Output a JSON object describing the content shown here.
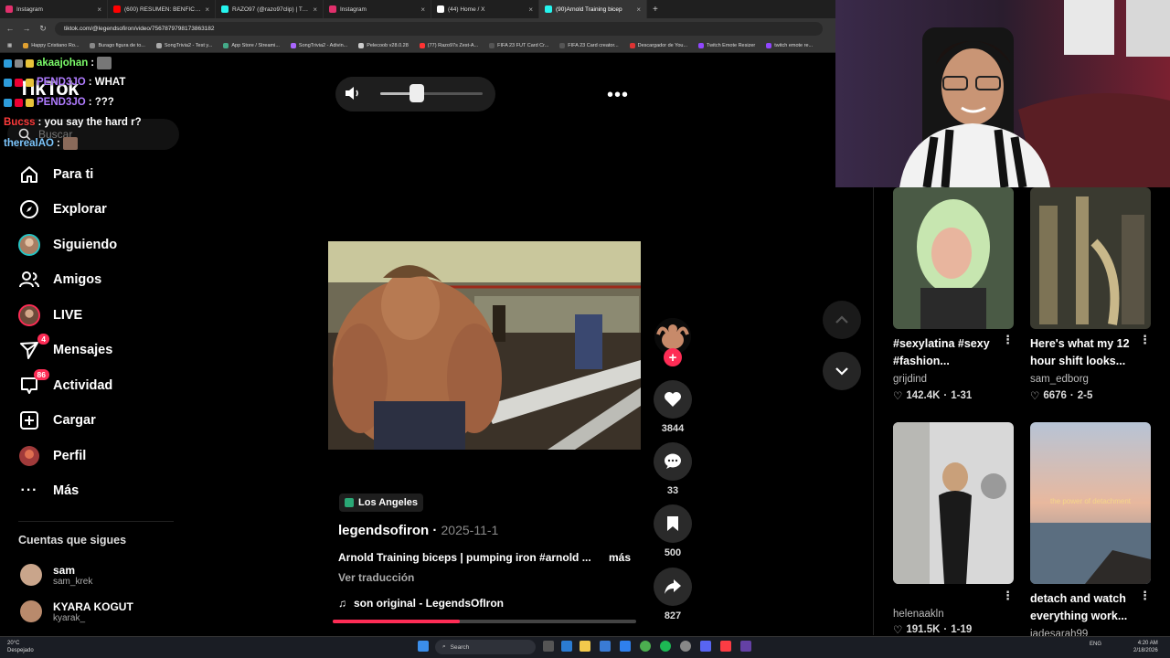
{
  "browser": {
    "tabs": [
      {
        "label": "Instagram",
        "color": "#e1306c"
      },
      {
        "label": "(600) RESUMEN: BENFICA 0-1 R",
        "color": "#ff0000"
      },
      {
        "label": "RAZO97 (@razo97clip) | TikTok",
        "color": "#25f4ee"
      },
      {
        "label": "Instagram",
        "color": "#e1306c"
      },
      {
        "label": "(44) Home / X",
        "color": "#ffffff"
      },
      {
        "label": "(90)Arnold Training bicep",
        "color": "#25f4ee"
      }
    ],
    "url": "tiktok.com/@legendsofiron/video/7567879798173863182",
    "bookmarks": [
      "Happy Cristiano Ro...",
      "Burago figura de to...",
      "SongTrivia2 - Test y...",
      "App Store / Streami...",
      "SongTrivia2 - Adivin...",
      "Pelecoob v28.0.28",
      "(77) Razo97s Zest-A...",
      "FIFA 23 FUT Card Cr...",
      "FIFA 23 Card creator...",
      "Descargador de You...",
      "Twitch Emote Resizer",
      "twitch emote re..."
    ]
  },
  "chat": [
    {
      "user": "akaajohan",
      "text": ":",
      "color": "#7cfc6a"
    },
    {
      "user": "PEND3JO",
      "text": ": WHAT",
      "color": "#b07cff"
    },
    {
      "user": "PEND3JO",
      "text": ": ???",
      "color": "#b07cff"
    },
    {
      "user": "Bucss",
      "text": ": you say the hard r?",
      "color": "#ff3b3b"
    },
    {
      "user": "therealAO",
      "text": ":",
      "color": "#7ec8ff"
    }
  ],
  "sidebar": {
    "logo": "TikTok",
    "search_placeholder": "Buscar",
    "nav": [
      {
        "label": "Para ti"
      },
      {
        "label": "Explorar"
      },
      {
        "label": "Siguiendo"
      },
      {
        "label": "Amigos"
      },
      {
        "label": "LIVE"
      },
      {
        "label": "Mensajes",
        "badge": "4"
      },
      {
        "label": "Actividad",
        "badge": "86"
      },
      {
        "label": "Cargar"
      },
      {
        "label": "Perfil"
      },
      {
        "label": "Más"
      }
    ],
    "following_title": "Cuentas que sigues",
    "accounts": [
      {
        "name": "sam",
        "handle": "sam_krek"
      },
      {
        "name": "KYARA KOGUT",
        "handle": "kyarak_"
      }
    ]
  },
  "player": {
    "volume_fraction": 0.36
  },
  "video": {
    "location": "Los Angeles",
    "author": "legendsofiron",
    "date": "2025-11-1",
    "description": "Arnold Training biceps | pumping iron #arnold ...",
    "more_label": "más",
    "translate_label": "Ver traducción",
    "music": "son original - LegendsOfIron",
    "progress_fraction": 0.42,
    "likes": "3844",
    "comments": "33",
    "saves": "500",
    "shares": "827"
  },
  "suggestions": [
    {
      "title": "#sexylatina #sexy #fashion...",
      "user": "grijdind",
      "views": "142.4K",
      "date": "1-31",
      "colors": [
        "#4a5a45",
        "#c7e6b0"
      ]
    },
    {
      "title": "Here's what my 12 hour shift looks...",
      "user": "sam_edborg",
      "views": "6676",
      "date": "2-5",
      "colors": [
        "#3a3a30",
        "#9d8f6a"
      ]
    },
    {
      "title": "",
      "user": "helenaakln",
      "views": "191.5K",
      "date": "1-19",
      "colors": [
        "#cfcfcf",
        "#6b6060"
      ]
    },
    {
      "title": "detach and watch everything work...",
      "user": "jadesarah99",
      "views": "",
      "date": "",
      "overlay": "the power of detachment",
      "colors": [
        "#e0b49a",
        "#6a7f94"
      ]
    }
  ],
  "taskbar": {
    "weather_temp": "20°C",
    "weather_desc": "Despejado",
    "search_label": "Search",
    "lang": "ENG",
    "time": "4:20 AM",
    "date": "2/18/2026"
  },
  "colors": {
    "accent": "#fe2c55",
    "background": "#000000"
  }
}
